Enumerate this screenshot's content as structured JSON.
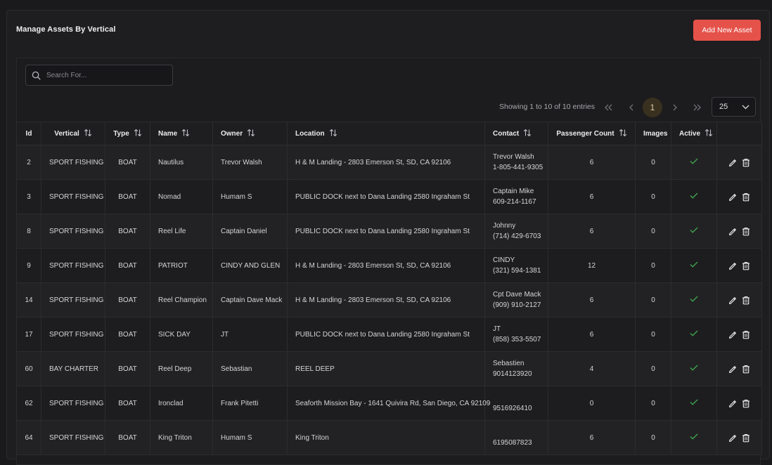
{
  "page": {
    "title": "Manage Assets By Vertical",
    "add_button": "Add New Asset"
  },
  "search": {
    "placeholder": "Search For..."
  },
  "pagination": {
    "showing": "Showing 1 to 10 of 10 entries",
    "current_page": "1",
    "page_size": "25"
  },
  "table": {
    "headers": [
      "Id",
      "Vertical",
      "Type",
      "Name",
      "Owner",
      "Location",
      "Contact",
      "Passenger Count",
      "Images",
      "Active",
      ""
    ],
    "rows": [
      {
        "id": "2",
        "vertical": "SPORT FISHING",
        "type": "BOAT",
        "name": "Nautilus",
        "owner": "Trevor Walsh",
        "location": "H & M Landing - 2803 Emerson St, SD, CA 92106",
        "contact_name": "Trevor Walsh",
        "contact_phone": "1-805-441-9305",
        "passengers": "6",
        "images": "0",
        "active": true
      },
      {
        "id": "3",
        "vertical": "SPORT FISHING",
        "type": "BOAT",
        "name": "Nomad",
        "owner": "Humam S",
        "location": "PUBLIC DOCK next to Dana Landing 2580 Ingraham St",
        "contact_name": "Captain Mike",
        "contact_phone": "609-214-1167",
        "passengers": "6",
        "images": "0",
        "active": true
      },
      {
        "id": "8",
        "vertical": "SPORT FISHING",
        "type": "BOAT",
        "name": "Reel Life",
        "owner": "Captain Daniel",
        "location": "PUBLIC DOCK next to Dana Landing 2580 Ingraham St",
        "contact_name": "Johnny",
        "contact_phone": "(714) 429-6703",
        "passengers": "6",
        "images": "0",
        "active": true
      },
      {
        "id": "9",
        "vertical": "SPORT FISHING",
        "type": "BOAT",
        "name": "PATRIOT",
        "owner": "CINDY AND GLEN",
        "location": "H & M Landing - 2803 Emerson St, SD, CA 92106",
        "contact_name": "CINDY",
        "contact_phone": "(321) 594-1381",
        "passengers": "12",
        "images": "0",
        "active": true
      },
      {
        "id": "14",
        "vertical": "SPORT FISHING",
        "type": "BOAT",
        "name": "Reel Champion",
        "owner": "Captain Dave Mack",
        "location": "H & M Landing - 2803 Emerson St, SD, CA 92106",
        "contact_name": "Cpt Dave Mack",
        "contact_phone": "(909) 910-2127",
        "passengers": "6",
        "images": "0",
        "active": true
      },
      {
        "id": "17",
        "vertical": "SPORT FISHING",
        "type": "BOAT",
        "name": "SICK DAY",
        "owner": "JT",
        "location": "PUBLIC DOCK next to Dana Landing 2580 Ingraham St",
        "contact_name": "JT",
        "contact_phone": "(858) 353-5507",
        "passengers": "6",
        "images": "0",
        "active": true
      },
      {
        "id": "60",
        "vertical": "BAY CHARTER",
        "type": "BOAT",
        "name": "Reel Deep",
        "owner": "Sebastian",
        "location": "REEL DEEP",
        "contact_name": "Sebastien",
        "contact_phone": "9014123920",
        "passengers": "4",
        "images": "0",
        "active": true
      },
      {
        "id": "62",
        "vertical": "SPORT FISHING",
        "type": "BOAT",
        "name": "Ironclad",
        "owner": "Frank Pitetti",
        "location": "Seaforth Mission Bay - 1641 Quivira Rd, San Diego, CA 92109",
        "contact_name": "",
        "contact_phone": "9516926410",
        "passengers": "0",
        "images": "0",
        "active": true
      },
      {
        "id": "64",
        "vertical": "SPORT FISHING",
        "type": "BOAT",
        "name": "King Triton",
        "owner": "Humam S",
        "location": "King Triton",
        "contact_name": "",
        "contact_phone": "6195087823",
        "passengers": "6",
        "images": "0",
        "active": true
      }
    ]
  },
  "colors": {
    "accent": "#e5524a",
    "check": "#3fa34d",
    "page_active": "#3a3020"
  }
}
